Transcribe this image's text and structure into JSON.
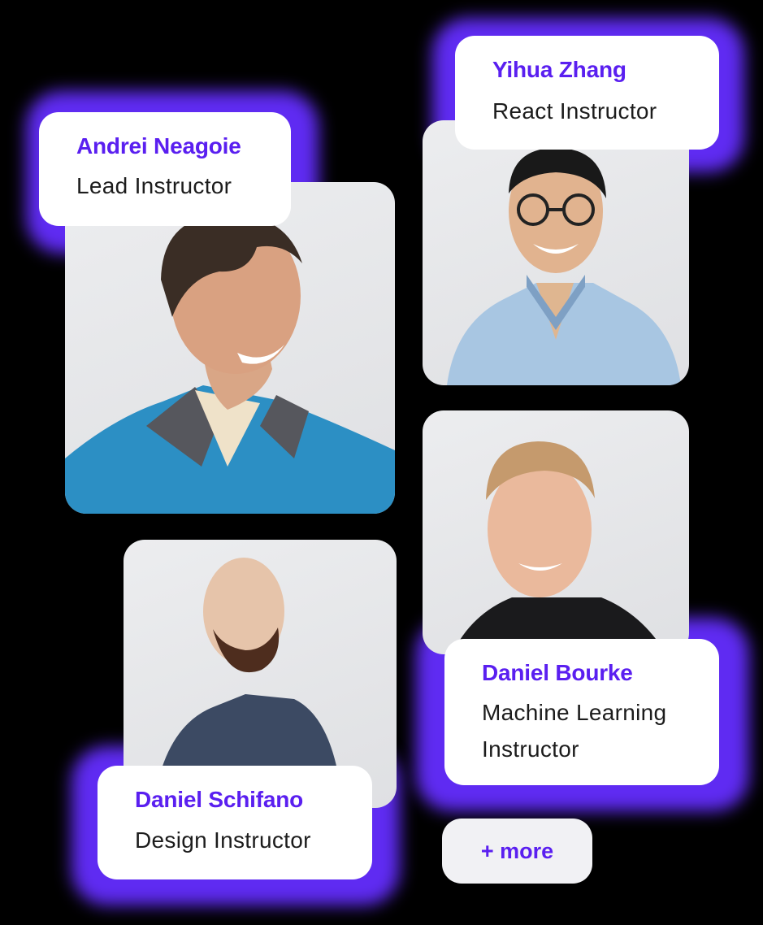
{
  "colors": {
    "accent": "#5a1ff0",
    "glow": "#5f2bf2",
    "background": "#000000",
    "card": "#ffffff"
  },
  "instructors": [
    {
      "name": "Andrei Neagoie",
      "role": "Lead Instructor"
    },
    {
      "name": "Yihua Zhang",
      "role": "React Instructor"
    },
    {
      "name": "Daniel Bourke",
      "role": "Machine Learning Instructor"
    },
    {
      "name": "Daniel Schifano",
      "role": "Design Instructor"
    }
  ],
  "more_label": "+ more"
}
